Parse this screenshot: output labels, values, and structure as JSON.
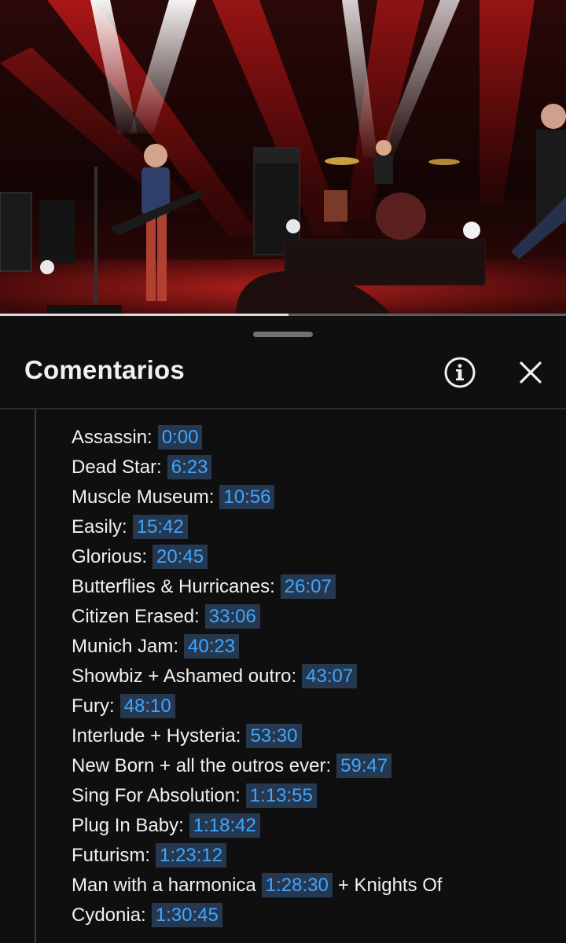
{
  "video": {
    "progress_fraction": 0.51
  },
  "panel": {
    "title": "Comentarios",
    "info_icon": "info-icon",
    "close_icon": "close-icon"
  },
  "comment": {
    "setlist": [
      {
        "song": "Assassin:",
        "time": "0:00"
      },
      {
        "song": "Dead Star:",
        "time": "6:23"
      },
      {
        "song": "Muscle Museum:",
        "time": "10:56"
      },
      {
        "song": "Easily:",
        "time": "15:42"
      },
      {
        "song": "Glorious:",
        "time": "20:45"
      },
      {
        "song": "Butterflies & Hurricanes:",
        "time": "26:07"
      },
      {
        "song": "Citizen Erased:",
        "time": "33:06"
      },
      {
        "song": "Munich Jam:",
        "time": "40:23"
      },
      {
        "song": "Showbiz + Ashamed outro:",
        "time": "43:07"
      },
      {
        "song": "Fury:",
        "time": "48:10"
      },
      {
        "song": "Interlude + Hysteria:",
        "time": "53:30"
      },
      {
        "song": "New Born + all the outros ever:",
        "time": "59:47"
      },
      {
        "song": "Sing For Absolution:",
        "time": "1:13:55"
      },
      {
        "song": "Plug In Baby:",
        "time": "1:18:42"
      },
      {
        "song": "Futurism:",
        "time": "1:23:12"
      }
    ],
    "last": {
      "song": "Man with a harmonica",
      "time": "1:28:30",
      "suffix": "+ Knights Of",
      "song2": "Cydonia:",
      "time2": "1:30:45"
    }
  }
}
